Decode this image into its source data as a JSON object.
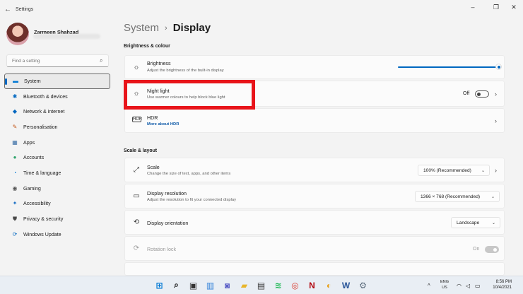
{
  "window": {
    "title": "Settings",
    "minimize": "–",
    "maximize": "❐",
    "close": "✕"
  },
  "profile": {
    "name": "Zarmeen Shahzad"
  },
  "search": {
    "placeholder": "Find a setting"
  },
  "nav": [
    {
      "label": "System",
      "icon": "display-icon",
      "glyph": "▬",
      "color": "#0078d4",
      "active": true
    },
    {
      "label": "Bluetooth & devices",
      "icon": "bluetooth-icon",
      "glyph": "✱",
      "color": "#0067c0"
    },
    {
      "label": "Network & internet",
      "icon": "wifi-icon",
      "glyph": "◆",
      "color": "#0067c0"
    },
    {
      "label": "Personalisation",
      "icon": "brush-icon",
      "glyph": "✎",
      "color": "#c2571a"
    },
    {
      "label": "Apps",
      "icon": "apps-icon",
      "glyph": "▦",
      "color": "#3a6ea5"
    },
    {
      "label": "Accounts",
      "icon": "person-icon",
      "glyph": "●",
      "color": "#2fa36b"
    },
    {
      "label": "Time & language",
      "icon": "globe-clock-icon",
      "glyph": "◔",
      "color": "#0f7fd6"
    },
    {
      "label": "Gaming",
      "icon": "gamepad-icon",
      "glyph": "◉",
      "color": "#555555"
    },
    {
      "label": "Accessibility",
      "icon": "accessibility-icon",
      "glyph": "✦",
      "color": "#1a6fc4"
    },
    {
      "label": "Privacy & security",
      "icon": "shield-icon",
      "glyph": "⛊",
      "color": "#4a4a4a"
    },
    {
      "label": "Windows Update",
      "icon": "update-icon",
      "glyph": "⟳",
      "color": "#0067c0"
    }
  ],
  "breadcrumb": {
    "parent": "System",
    "separator": "›",
    "current": "Display"
  },
  "sections": {
    "brightness": "Brightness & colour",
    "scale": "Scale & layout"
  },
  "cards": {
    "brightness": {
      "title": "Brightness",
      "subtitle": "Adjust the brightness of the built-in display",
      "level": 1.0
    },
    "night_light": {
      "title": "Night light",
      "subtitle": "Use warmer colours to help block blue light",
      "state": "Off"
    },
    "hdr": {
      "title": "HDR",
      "link": "More about HDR"
    },
    "scale": {
      "title": "Scale",
      "subtitle": "Change the size of text, apps, and other items",
      "value": "100% (Recommended)"
    },
    "resolution": {
      "title": "Display resolution",
      "subtitle": "Adjust the resolution to fit your connected display",
      "value": "1366 × 768 (Recommended)"
    },
    "orientation": {
      "title": "Display orientation",
      "value": "Landscape"
    },
    "rotation": {
      "title": "Rotation lock",
      "state": "On"
    }
  },
  "taskbar": {
    "lang_top": "ENG",
    "lang_bottom": "US",
    "time": "8:56 PM",
    "date": "10/4/2021",
    "apps": [
      {
        "name": "start-button",
        "glyph": "⊞",
        "color": "#0078d4"
      },
      {
        "name": "search-icon",
        "glyph": "⌕",
        "color": "#1b1b1b"
      },
      {
        "name": "task-view-icon",
        "glyph": "▣",
        "color": "#333333"
      },
      {
        "name": "widgets-icon",
        "glyph": "▥",
        "color": "#2f7fd8"
      },
      {
        "name": "chat-icon",
        "glyph": "◙",
        "color": "#5b5fc7"
      },
      {
        "name": "file-explorer-icon",
        "glyph": "▰",
        "color": "#e8b52b"
      },
      {
        "name": "store-icon",
        "glyph": "▤",
        "color": "#3a3a3a"
      },
      {
        "name": "spotify-icon",
        "glyph": "≋",
        "color": "#1db954"
      },
      {
        "name": "chrome-icon",
        "glyph": "◎",
        "color": "#db4437"
      },
      {
        "name": "netflix-icon",
        "glyph": "N",
        "color": "#b20710"
      },
      {
        "name": "app-icon",
        "glyph": "◐",
        "color": "#e8a01a"
      },
      {
        "name": "word-icon",
        "glyph": "W",
        "color": "#2b579a"
      },
      {
        "name": "settings-icon",
        "glyph": "⚙",
        "color": "#607080"
      }
    ]
  }
}
